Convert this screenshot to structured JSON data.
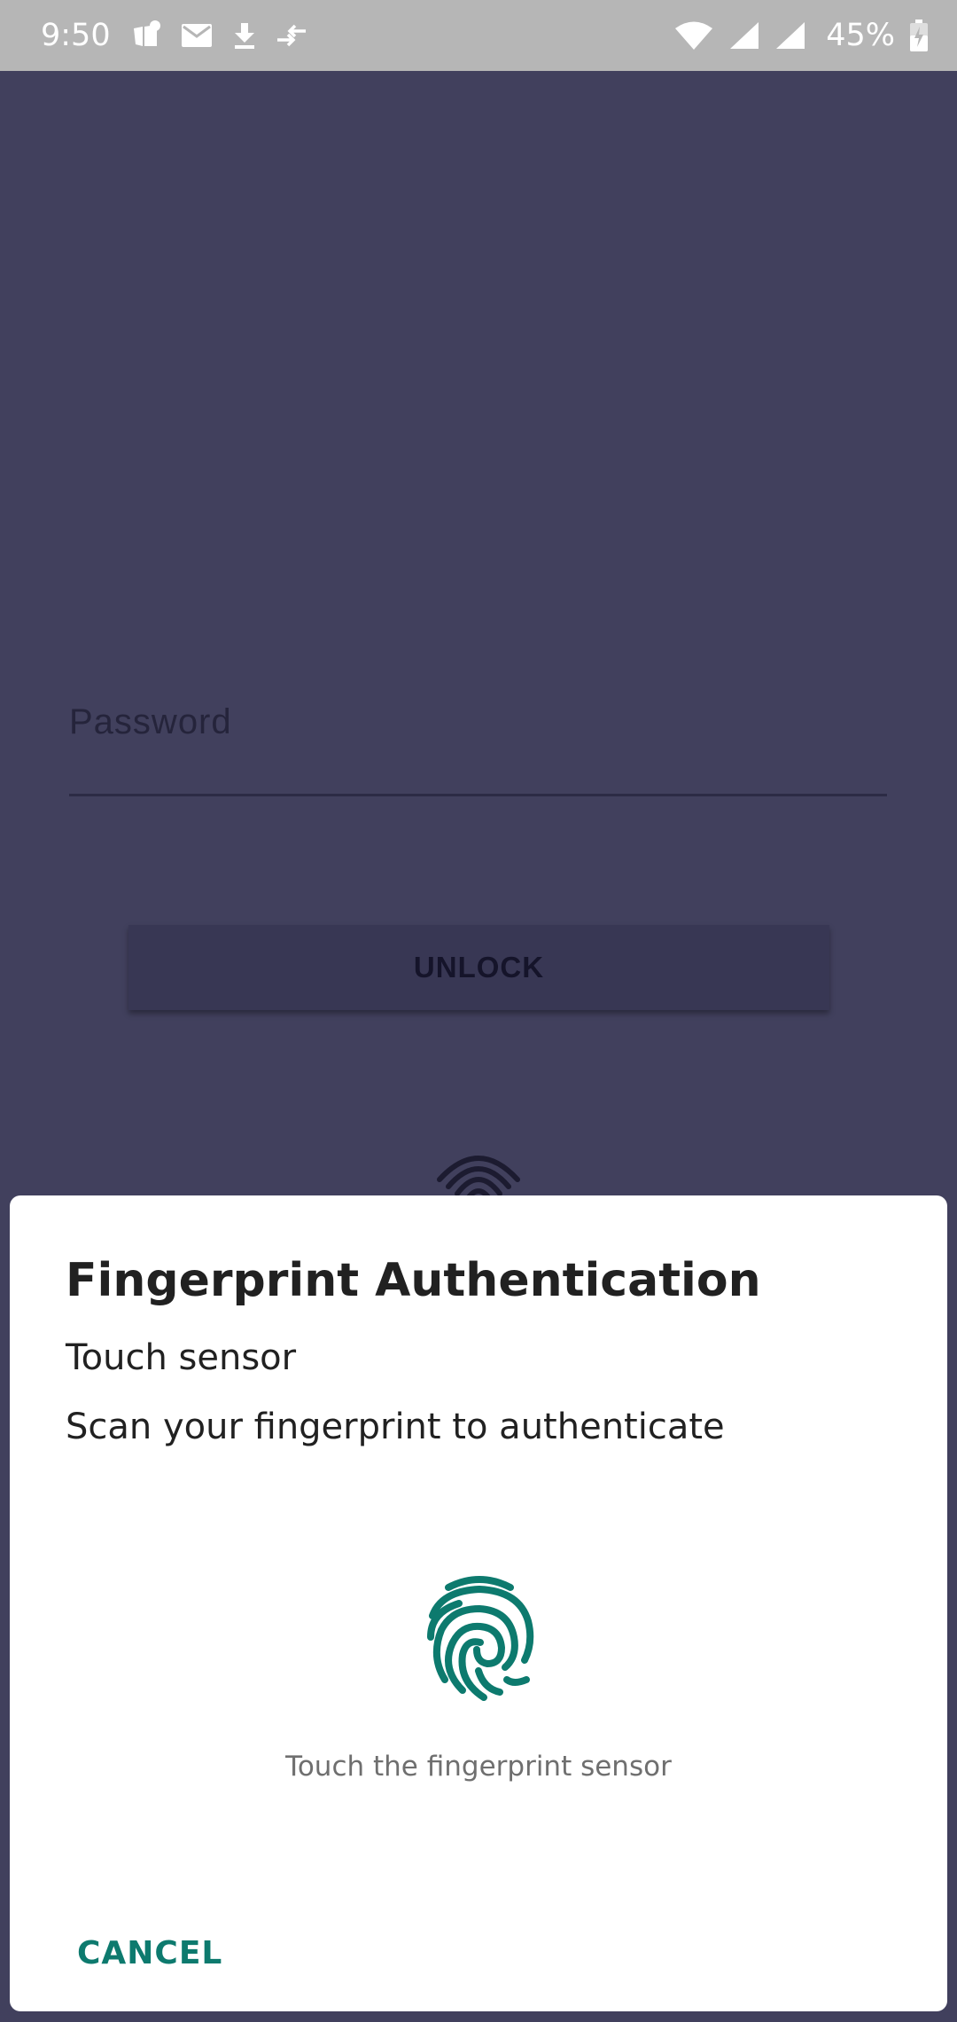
{
  "status_bar": {
    "time": "9:50",
    "battery": "45%",
    "left_icons": [
      "app-notification-icon",
      "email-icon",
      "download-icon",
      "data-transfer-icon"
    ],
    "right_icons": [
      "wifi-icon",
      "signal-icon",
      "signal-icon",
      "battery-charging-icon"
    ]
  },
  "app": {
    "password": {
      "placeholder": "Password",
      "value": ""
    },
    "unlock_label": "UNLOCK"
  },
  "dialog": {
    "title": "Fingerprint Authentication",
    "subtitle": "Touch sensor",
    "description": "Scan your fingerprint to authenticate",
    "status": "Touch the fingerprint sensor",
    "cancel_label": "CANCEL",
    "accent_color": "#0d7a6e"
  },
  "colors": {
    "scrim_background": "#41405d",
    "status_bar": "#b6b6b6",
    "dialog_background": "#ffffff"
  }
}
